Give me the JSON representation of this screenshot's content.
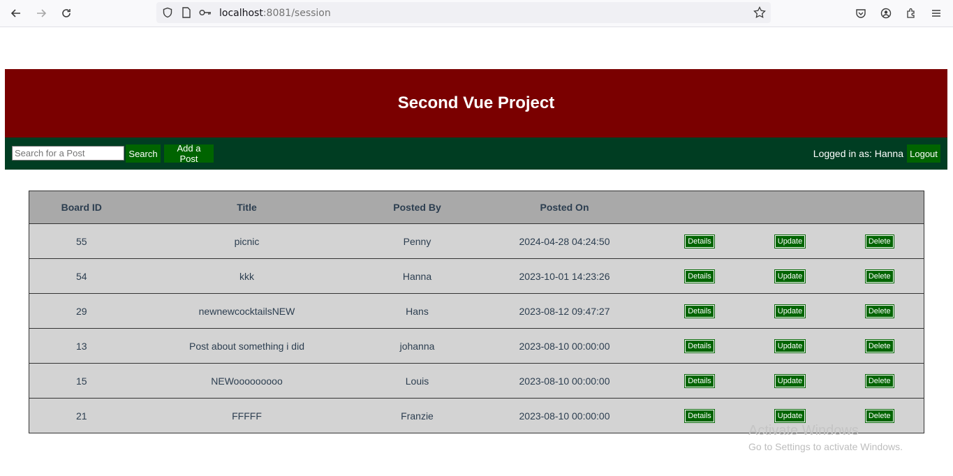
{
  "browser": {
    "url_host": "localhost",
    "url_rest": ":8081/session"
  },
  "header": {
    "title": "Second Vue Project"
  },
  "nav": {
    "search_placeholder": "Search for a Post",
    "search_label": "Search",
    "add_label": "Add a Post",
    "logged_in_text": "Logged in as: Hanna",
    "logout_label": "Logout"
  },
  "table": {
    "columns": [
      "Board ID",
      "Title",
      "Posted By",
      "Posted On",
      "",
      "",
      ""
    ],
    "actions": [
      "Details",
      "Update",
      "Delete"
    ],
    "rows": [
      {
        "id": "55",
        "title": "picnic",
        "by": "Penny",
        "on": "2024-04-28 04:24:50"
      },
      {
        "id": "54",
        "title": "kkk",
        "by": "Hanna",
        "on": "2023-10-01 14:23:26"
      },
      {
        "id": "29",
        "title": "newnewcocktailsNEW",
        "by": "Hans",
        "on": "2023-08-12 09:47:27"
      },
      {
        "id": "13",
        "title": "Post about something i did",
        "by": "johanna",
        "on": "2023-08-10 00:00:00"
      },
      {
        "id": "15",
        "title": "NEWooooooooo",
        "by": "Louis",
        "on": "2023-08-10 00:00:00"
      },
      {
        "id": "21",
        "title": "FFFFF",
        "by": "Franzie",
        "on": "2023-08-10 00:00:00"
      }
    ]
  },
  "watermark": {
    "line1": "Activate Windows",
    "line2": "Go to Settings to activate Windows."
  },
  "colors": {
    "banner": "#7a0000",
    "navbar": "#003d22",
    "button": "#006400",
    "table_header": "#a9a9a9",
    "table_row": "#d3d3d3"
  }
}
